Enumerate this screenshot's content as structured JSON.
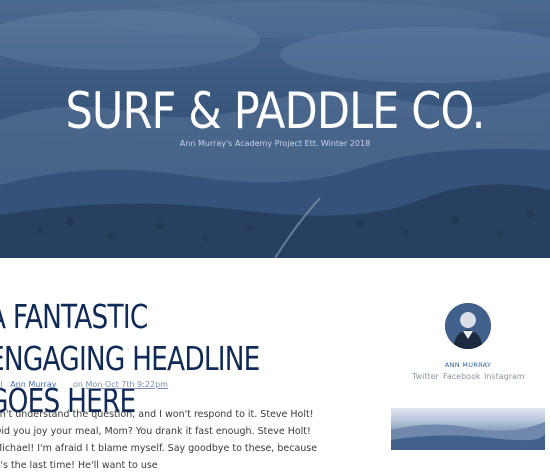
{
  "hero": {
    "title": "SURF & PADDLE CO.",
    "subtitle": "Ann Murray's Academy Project Ett. Winter 2018"
  },
  "article": {
    "headline": "A FANTASTIC ENGAGING HEADLINE GOES HERE",
    "author": "Ann Murray",
    "date_prefix": "on",
    "date": "Mon Oct 7th 9:22pm",
    "body": "on't understand the question, and I won't respond to it. Steve Holt! Did you joy your meal, Mom? You drank it fast enough. Steve Holt! Michael! I'm afraid I t blame myself. Say goodbye to these, because it's the last time! He'll want to use"
  },
  "sidebar": {
    "author_name": "ANN MURRAY",
    "social": [
      "Twitter",
      "Facebook",
      "Instagram"
    ]
  },
  "colors": {
    "hero_overlay": "#3e5b82",
    "headline": "#0f2a57",
    "link": "#3e6fb0"
  }
}
